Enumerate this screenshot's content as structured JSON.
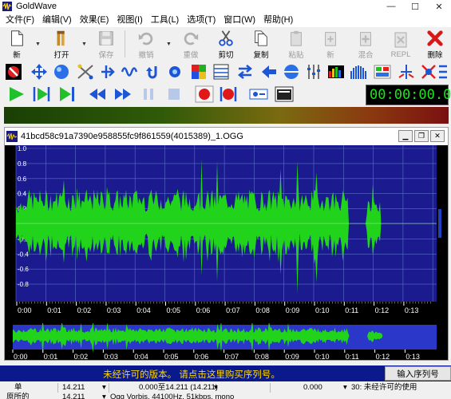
{
  "app": {
    "title": "GoldWave",
    "window_controls": [
      "—",
      "☐",
      "✕"
    ]
  },
  "menu": [
    "文件(F)",
    "编辑(V)",
    "效果(E)",
    "视图(I)",
    "工具(L)",
    "选项(T)",
    "窗口(W)",
    "帮助(H)"
  ],
  "toolbar": {
    "buttons": [
      {
        "label": "新",
        "icon": "new-file-icon",
        "enabled": true
      },
      {
        "label": "打开",
        "icon": "open-folder-icon",
        "enabled": true
      },
      {
        "label": "保存",
        "icon": "save-disk-icon",
        "enabled": false
      },
      {
        "label": "撤销",
        "icon": "undo-icon",
        "enabled": false
      },
      {
        "label": "重做",
        "icon": "redo-icon",
        "enabled": false
      },
      {
        "label": "剪切",
        "icon": "scissors-icon",
        "enabled": true
      },
      {
        "label": "复制",
        "icon": "copy-icon",
        "enabled": true
      },
      {
        "label": "粘贴",
        "icon": "paste-icon",
        "enabled": false
      },
      {
        "label": "新",
        "icon": "paste-new-icon",
        "enabled": false
      },
      {
        "label": "混合",
        "icon": "mix-icon",
        "enabled": false
      },
      {
        "label": "REPL",
        "icon": "replace-icon",
        "enabled": false
      },
      {
        "label": "删除",
        "icon": "delete-x-icon",
        "enabled": true
      }
    ]
  },
  "transport": {
    "time": "00:00:00.0"
  },
  "colors": {
    "wave_bg": "#1b1b8f",
    "wave_green": "#22d31b",
    "grid": "#5a6fc8",
    "promo_bg": "#0a1a8c",
    "promo_text": "#ffd800",
    "time_green": "#1ee31e"
  },
  "sound_window": {
    "title": "41bcd58c91a7390e958855fc9f861559(4015389)_1.OGG",
    "y_labels": [
      "1.0",
      "0.8",
      "0.6",
      "0.4",
      "0.2",
      "0.0",
      "-0.2",
      "-0.4",
      "-0.6",
      "-0.8"
    ],
    "time_labels": [
      "0:00",
      "0:01",
      "0:02",
      "0:03",
      "0:04",
      "0:05",
      "0:06",
      "0:07",
      "0:08",
      "0:09",
      "0:10",
      "0:11",
      "0:12",
      "0:13"
    ]
  },
  "status": {
    "promo": "未经许可的版本。 请点击这里购买序列号。",
    "serial_button": "输入序列号",
    "row1": {
      "label": "单",
      "v1": "14.211",
      "v2": "0.000至14.211 (14.211)",
      "v3": "0.000",
      "msg": "30: 未经许可的使用"
    },
    "row2": {
      "label": "原所的",
      "v1": "14.211",
      "format": "Ogg Vorbis, 44100Hz, 51kbps, mono"
    }
  }
}
